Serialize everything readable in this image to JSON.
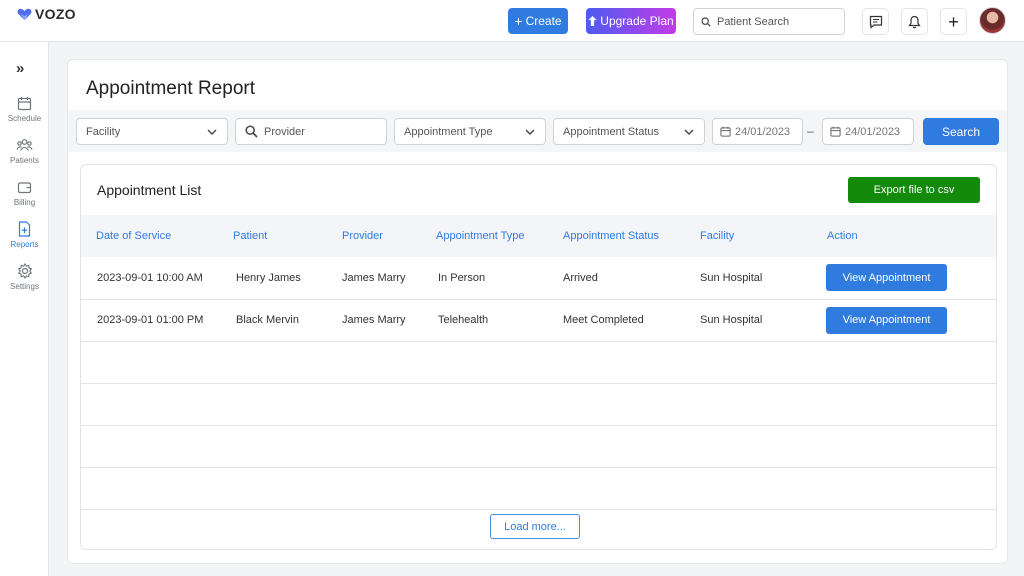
{
  "app": {
    "logo_text": "VOZO"
  },
  "header": {
    "create_label": "Create",
    "upgrade_label": "Upgrade Plan",
    "search_placeholder": "Patient Search"
  },
  "sidebar": {
    "items": [
      {
        "label": "Schedule",
        "icon": "calendar-icon"
      },
      {
        "label": "Patients",
        "icon": "users-icon"
      },
      {
        "label": "Billing",
        "icon": "wallet-icon"
      },
      {
        "label": "Reports",
        "icon": "report-icon",
        "active": true
      },
      {
        "label": "Settings",
        "icon": "gear-icon"
      }
    ]
  },
  "page": {
    "title": "Appointment Report"
  },
  "filters": {
    "facility": "Facility",
    "provider_placeholder": "Provider",
    "appointment_type": "Appointment Type",
    "appointment_status": "Appointment Status",
    "date_from": "24/01/2023",
    "date_separator": "–",
    "date_to": "24/01/2023",
    "search_label": "Search"
  },
  "list": {
    "title": "Appointment List",
    "export_label": "Export file to csv",
    "columns": [
      "Date of Service",
      "Patient",
      "Provider",
      "Appointment Type",
      "Appointment Status",
      "Facility",
      "Action"
    ],
    "rows": [
      {
        "date": "2023-09-01 10:00 AM",
        "patient": "Henry James",
        "provider": "James Marry",
        "type": "In Person",
        "status": "Arrived",
        "facility": "Sun Hospital",
        "action": "View Appointment"
      },
      {
        "date": "2023-09-01 01:00 PM",
        "patient": "Black Mervin",
        "provider": "James Marry",
        "type": "Telehealth",
        "status": "Meet Completed",
        "facility": "Sun Hospital",
        "action": "View Appointment"
      }
    ],
    "load_more_label": "Load more..."
  },
  "colors": {
    "primary": "#2f7be0",
    "export_green": "#138a0a"
  }
}
